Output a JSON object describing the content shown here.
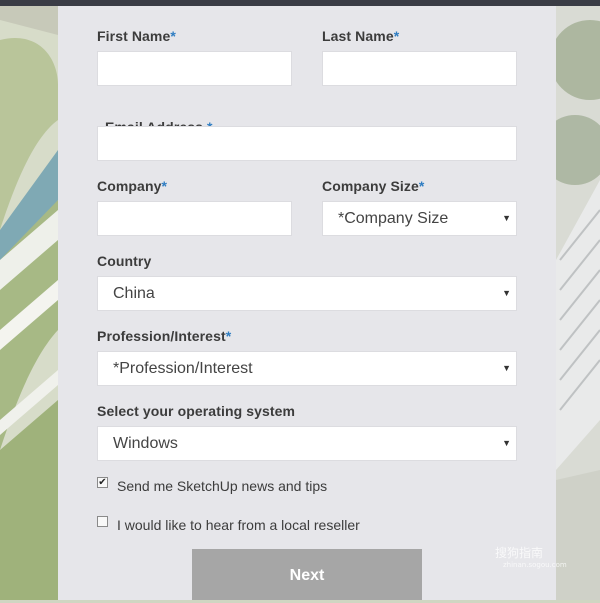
{
  "form": {
    "first_name": {
      "label": "First Name",
      "required": "*"
    },
    "last_name": {
      "label": "Last Name",
      "required": "*"
    },
    "email": {
      "label": "Email Address ",
      "required": "*"
    },
    "company": {
      "label": "Company",
      "required": "*"
    },
    "company_size": {
      "label": "Company Size",
      "required": "*",
      "value": "*Company Size"
    },
    "country": {
      "label": "Country",
      "value": "China"
    },
    "profession": {
      "label": "Profession/Interest",
      "required": "*",
      "value": "*Profession/Interest"
    },
    "os": {
      "label": "Select your operating system",
      "value": "Windows"
    },
    "news_checkbox": {
      "label": "Send me SketchUp news and tips",
      "checked": true
    },
    "reseller_checkbox": {
      "label": "I would like to hear from a local reseller",
      "checked": false
    },
    "next_button": "Next"
  },
  "watermark": {
    "text": "搜狗指南",
    "sub": "zhinan.sogou.com"
  },
  "colors": {
    "required_mark": "#2f7dc2",
    "panel": "#e6e6ea",
    "button": "#a6a6a6"
  },
  "icons": {
    "dropdown": "triangle-down",
    "checkmark": "check"
  }
}
